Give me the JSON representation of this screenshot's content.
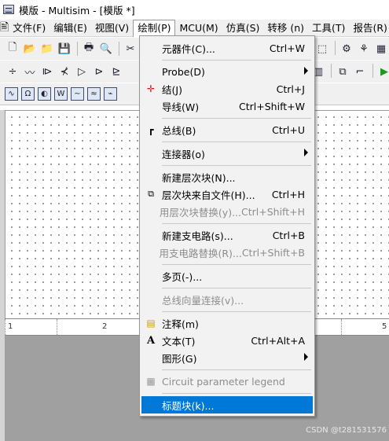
{
  "window": {
    "title": "模版 - Multisim - [模版 *]"
  },
  "menubar": {
    "items": [
      "文件(F)",
      "编辑(E)",
      "视图(V)",
      "绘制(P)",
      "MCU(M)",
      "仿真(S)",
      "转移 (n)",
      "工具(T)",
      "报告(R)"
    ]
  },
  "draw_menu": {
    "items": [
      {
        "label": "元器件(C)...",
        "shortcut": "Ctrl+W",
        "icon": ""
      },
      {
        "label": "Probe(D)",
        "shortcut": "",
        "icon": "",
        "submenu": true
      },
      {
        "label": "结(J)",
        "shortcut": "Ctrl+J",
        "icon": "junction-icon"
      },
      {
        "label": "导线(W)",
        "shortcut": "Ctrl+Shift+W",
        "icon": ""
      },
      {
        "label": "总线(B)",
        "shortcut": "Ctrl+U",
        "icon": "bus-icon"
      },
      {
        "label": "连接器(o)",
        "shortcut": "",
        "icon": "",
        "submenu": true
      },
      {
        "label": "新建层次块(N)...",
        "shortcut": "",
        "icon": ""
      },
      {
        "label": "层次块来自文件(H)...",
        "shortcut": "Ctrl+H",
        "icon": "hierarchical-block-icon"
      },
      {
        "label": "用层次块替换(y)...",
        "shortcut": "Ctrl+Shift+H",
        "icon": "",
        "disabled": true
      },
      {
        "label": "新建支电路(s)...",
        "shortcut": "Ctrl+B",
        "icon": ""
      },
      {
        "label": "用支电路替换(R)...",
        "shortcut": "Ctrl+Shift+B",
        "icon": "",
        "disabled": true
      },
      {
        "label": "多页(-)...",
        "shortcut": "",
        "icon": ""
      },
      {
        "label": "总线向量连接(v)...",
        "shortcut": "",
        "icon": "",
        "disabled": true
      },
      {
        "label": "注释(m)",
        "shortcut": "",
        "icon": "comment-icon"
      },
      {
        "label": "文本(T)",
        "shortcut": "Ctrl+Alt+A",
        "icon": "text-icon"
      },
      {
        "label": "图形(G)",
        "shortcut": "",
        "icon": "",
        "submenu": true
      },
      {
        "label": "Circuit parameter legend",
        "shortcut": "",
        "icon": "legend-icon",
        "disabled": true
      },
      {
        "label": "标题块(k)...",
        "shortcut": "",
        "icon": "",
        "highlighted": true
      }
    ]
  },
  "ruler": {
    "labels": [
      "1",
      "2",
      "5"
    ]
  },
  "watermark": "CSDN @t281531576",
  "colors": {
    "highlight": "#0078d7",
    "menu_bg": "#f2f2f2",
    "disabled": "#8d8d8d"
  }
}
